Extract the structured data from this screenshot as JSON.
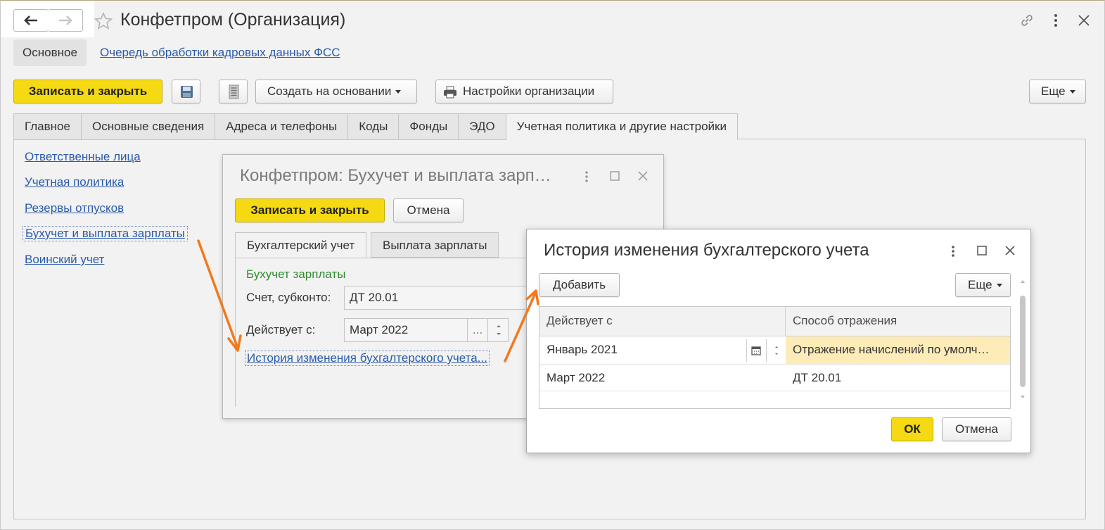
{
  "window": {
    "title": "Конфетпром (Организация)",
    "tabs_top": {
      "main": "Основное",
      "link": "Очередь обработки кадровых данных ФСС"
    }
  },
  "toolbar": {
    "save_close": "Записать и закрыть",
    "create_based": "Создать на основании",
    "org_settings": "Настройки организации",
    "more": "Еще"
  },
  "tabs": [
    "Главное",
    "Основные сведения",
    "Адреса и телефоны",
    "Коды",
    "Фонды",
    "ЭДО",
    "Учетная политика и другие настройки"
  ],
  "sidebar": [
    "Ответственные лица",
    "Учетная политика",
    "Резервы отпусков",
    "Бухучет и выплата зарплаты",
    "Воинский учет"
  ],
  "dialog1": {
    "title": "Конфетпром: Бухучет и выплата зарп…",
    "save_close": "Записать и закрыть",
    "cancel": "Отмена",
    "tabs": [
      "Бухгалтерский учет",
      "Выплата зарплаты"
    ],
    "section": "Бухучет зарплаты",
    "account_label": "Счет, субконто:",
    "account_value": "ДТ 20.01",
    "date_label": "Действует с:",
    "date_value": "Март 2022",
    "ellipsis": "...",
    "history_link": "История изменения бухгалтерского учета..."
  },
  "dialog2": {
    "title": "История изменения бухгалтерского учета",
    "add": "Добавить",
    "more": "Еще",
    "columns": [
      "Действует с",
      "Способ отражения"
    ],
    "rows": [
      {
        "date": "Январь 2021",
        "method": "Отражение начислений по умолч…"
      },
      {
        "date": "Март 2022",
        "method": "ДТ 20.01"
      }
    ],
    "ok": "ОК",
    "cancel": "Отмена"
  },
  "colors": {
    "accent_yellow": "#f5d913",
    "link_blue": "#2a5ba9",
    "arrow_orange": "#f07a1e",
    "section_green": "#2e8b2e",
    "row_highlight": "#fdebb8"
  }
}
